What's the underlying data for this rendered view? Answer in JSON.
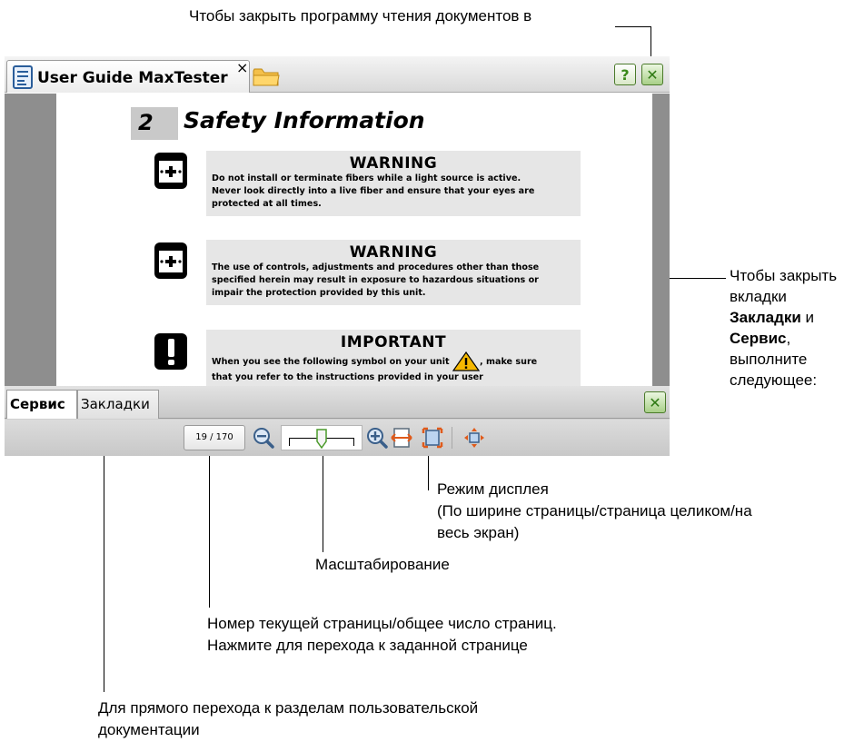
{
  "callouts": {
    "close_reader": "Чтобы закрыть программу чтения документов в",
    "close_tabs_line1": "Чтобы закрыть",
    "close_tabs_line2": "вкладки",
    "close_tabs_bold1": "Закладки",
    "close_tabs_and": " и",
    "close_tabs_bold2": "Сервис",
    "close_tabs_comma": ",",
    "close_tabs_line5": "выполните",
    "close_tabs_line6": "следующее:",
    "display_mode_line1": "Режим дисплея",
    "display_mode_line2": "(По ширине страницы/страница целиком/на",
    "display_mode_line3": "весь экран)",
    "zoom": "Масштабирование",
    "page_number_line1": "Номер текущей страницы/общее число страниц.",
    "page_number_line2": "Нажмите для перехода к заданной странице",
    "bookmarks_line1": "Для прямого перехода к разделам пользовательской",
    "bookmarks_line2": "документации"
  },
  "window": {
    "tab_title": "User Guide MaxTester",
    "tab_close_glyph": "×",
    "help_glyph": "?",
    "close_glyph": "✕"
  },
  "document": {
    "chapter_number": "2",
    "chapter_title": "Safety Information",
    "notices": [
      {
        "heading": "WARNING",
        "lines": [
          "Do not install or terminate fibers while a light source is active.",
          "Never look directly into a live fiber and ensure that your eyes are",
          "protected at all times."
        ]
      },
      {
        "heading": "WARNING",
        "lines": [
          "The use of controls, adjustments and procedures other than those",
          "specified herein may result in exposure to hazardous situations or",
          "impair the protection provided by this unit."
        ]
      },
      {
        "heading": "IMPORTANT",
        "line1_before": "When you see the following symbol on your unit",
        "line1_after": ", make sure",
        "line2": "that you refer to the instructions provided in your user"
      }
    ]
  },
  "bottom": {
    "tab_service": "Сервис",
    "tab_bookmarks": "Закладки",
    "page_indicator": "19 / 170",
    "zoom_level_fraction": 0.5
  },
  "colors": {
    "viewer_background": "#8e8e8e",
    "notice_background": "#e6e6e6",
    "close_button_green": "#2f7a14",
    "warning_triangle": "#f5b800"
  },
  "icons": {
    "document": "document-icon",
    "folder": "folder-icon",
    "help": "help-icon",
    "close": "close-icon",
    "zoom_out": "zoom-out-icon",
    "zoom_in": "zoom-in-icon",
    "fit_width": "fit-width-icon",
    "fit_page": "fit-page-icon",
    "full_screen": "full-screen-icon"
  }
}
